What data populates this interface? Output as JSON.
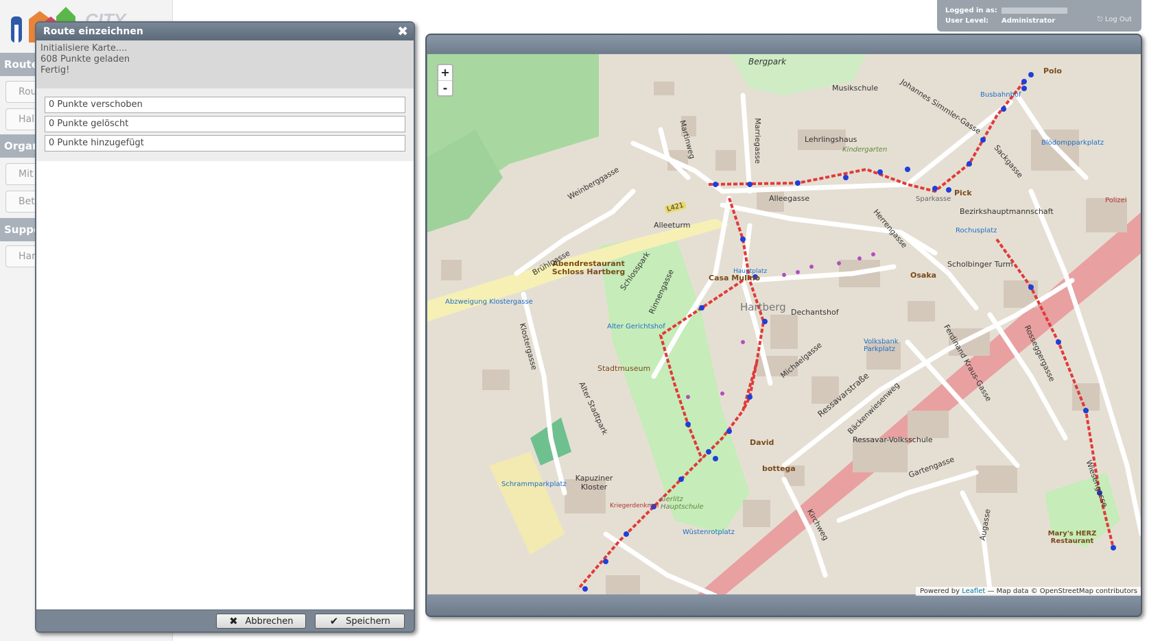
{
  "app": {
    "logo_text": "CITY",
    "sidebar_sections": [
      {
        "label": "Route",
        "buttons": [
          "Rou",
          "Hal"
        ]
      },
      {
        "label": "Organ",
        "buttons": [
          "Mit",
          "Bet"
        ]
      },
      {
        "label": "Suppo",
        "buttons": [
          "Har"
        ]
      }
    ],
    "login": {
      "logged_in_label": "Logged in as:",
      "user_level_label": "User Level:",
      "user_level_value": "Administrator",
      "logout_label": "Log Out"
    }
  },
  "dialog": {
    "title": "Route einzeichnen",
    "log_text": "Initialisiere Karte....\n608 Punkte geladen\nFertig!",
    "stats": [
      "0 Punkte verschoben",
      "0 Punkte gelöscht",
      "0 Punkte hinzugefügt"
    ],
    "cancel_label": "Abbrechen",
    "save_label": "Speichern"
  },
  "map": {
    "zoom_in": "+",
    "zoom_out": "-",
    "attribution": {
      "powered_by": "Powered by",
      "leaflet": "Leaflet",
      "data": "— Map data © OpenStreetMap contributors"
    },
    "street_labels": [
      "Weinberggasse",
      "Brühlgasse",
      "Martinweg",
      "Marriegasse",
      "Johannes Simmler-Gasse",
      "Sackgasse",
      "Alleegasse",
      "Klostergasse",
      "Alter Stadtpark",
      "Schlosspark",
      "Rinnengasse",
      "Michaelgasse",
      "Ressavarstraße",
      "Ferdinand Kraus-Gasse",
      "Bäckenwiesenweg",
      "Rosseggergasse",
      "Wiesengasse",
      "Gartengasse",
      "Kirchweg",
      "Augasse",
      "Herrengasse",
      "L421"
    ],
    "place_labels": [
      "Bergpark",
      "Musikschule",
      "Lehrlingshaus",
      "Kindergarten",
      "Sparkasse",
      "Bezirkshauptmannschaft",
      "Polizei",
      "Alleeturm",
      "Abendrestaurant Schloss Hartberg",
      "Casa Mulino",
      "Hartberg",
      "Dechantshof",
      "Osaka",
      "Scholbinger Turm",
      "Stadtmuseum",
      "Alter Gerichtshof",
      "Kapuziner Kloster",
      "Ressavar-Volksschule",
      "Schrammparkplatz",
      "Volksbank Parkplatz",
      "Blödompparkplatz",
      "Wüstenrotplatz",
      "Gerlitz Hauptschule",
      "David",
      "bottega",
      "Polo",
      "Pick",
      "Mary's HERZ Restaurant",
      "Abzweigung Klostergasse",
      "Rochusplatz",
      "Busbahnhof",
      "Kriegerdenkmal",
      "Hauptplatz"
    ]
  }
}
